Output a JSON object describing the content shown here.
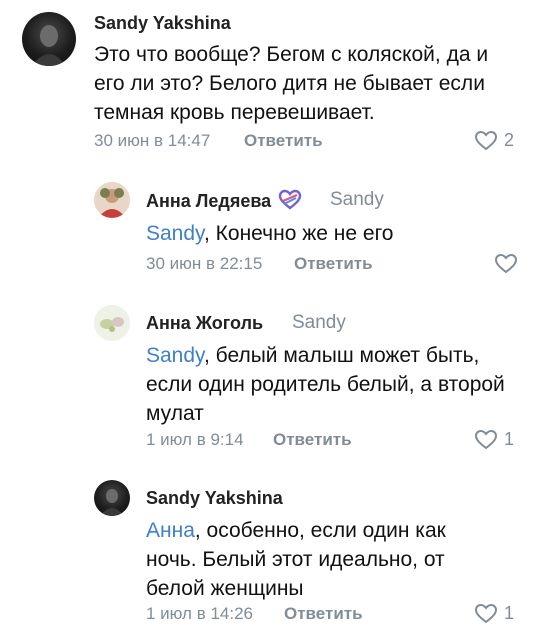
{
  "comments": [
    {
      "author": "Sandy Yakshina",
      "reply_to": "",
      "mention": "",
      "text": "Это что вообще?  Бегом с коляской, да и его ли это? Белого дитя не бывает если темная кровь перевешивает.",
      "date": "30 июн в 14:47",
      "reply_label": "Ответить",
      "likes": "2"
    },
    {
      "author": "Анна Ледяева",
      "reply_to": "Sandy",
      "mention": "Sandy",
      "text": ", Конечно же не его",
      "date": "30 июн в 22:15",
      "reply_label": "Ответить",
      "likes": ""
    },
    {
      "author": "Анна Жоголь",
      "reply_to": "Sandy",
      "mention": "Sandy",
      "text": ", белый малыш может быть, если один родитель белый, а второй мулат",
      "date": "1 июл в 9:14",
      "reply_label": "Ответить",
      "likes": "1"
    },
    {
      "author": "Sandy Yakshina",
      "reply_to": "",
      "mention": "Анна",
      "text": ", особенно, если один как ночь. Белый этот идеально, от белой женщины",
      "date": "1 июл в 14:26",
      "reply_label": "Ответить",
      "likes": "1"
    }
  ],
  "colors": {
    "mention": "#3f7fcb",
    "meta": "#818c99",
    "badge_purple": "#7a5fd0",
    "badge_pink": "#e0568a"
  },
  "icons": [
    "heart-icon",
    "heart-badge-icon"
  ]
}
